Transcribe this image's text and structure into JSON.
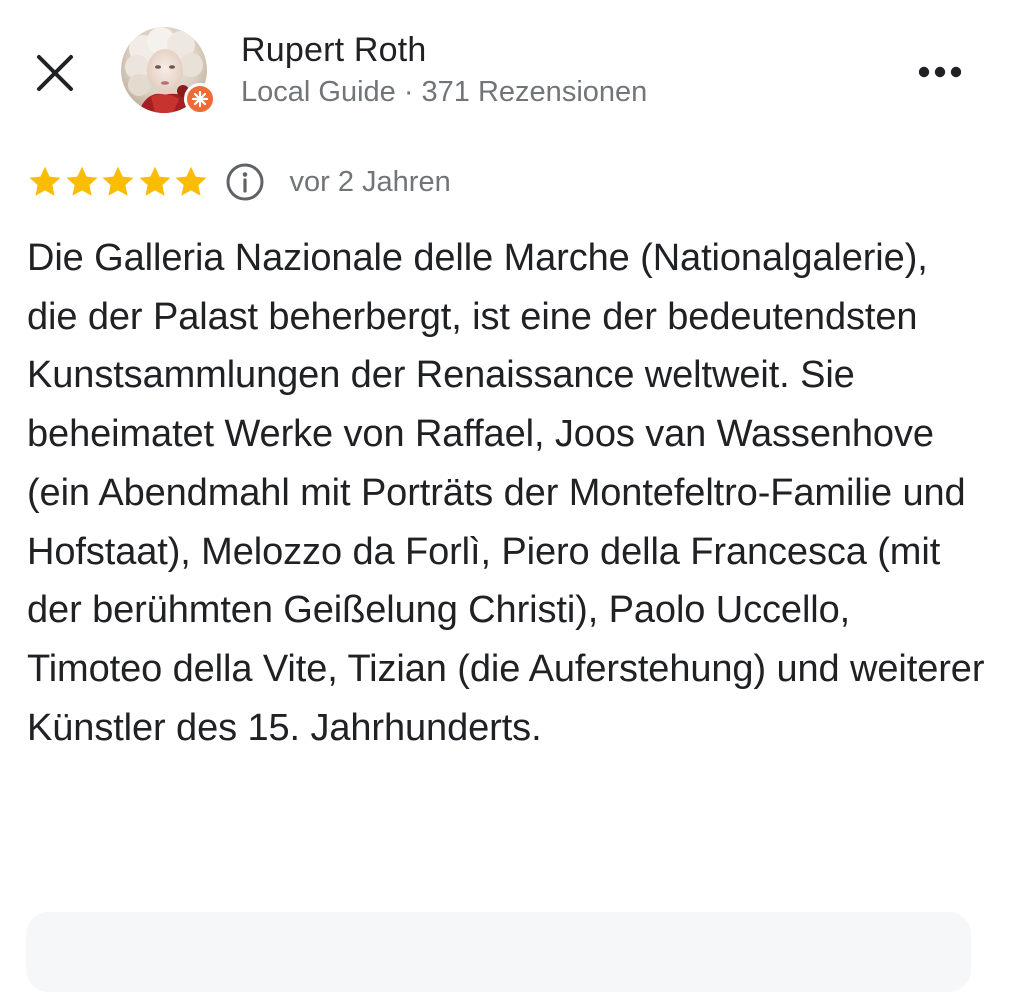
{
  "header": {
    "close_icon": "close-icon",
    "user_name": "Rupert Roth",
    "user_meta": "Local Guide · 371 Rezensionen",
    "badge_icon": "local-guide-badge-icon",
    "more_icon": "more-horizontal-icon"
  },
  "review": {
    "rating": 5,
    "rating_max": 5,
    "star_color": "#fbbc04",
    "info_icon": "info-icon",
    "date": "vor 2 Jahren",
    "text": "Die Galleria Nazionale delle Marche (Nationalgalerie), die der Palast beherbergt, ist eine der bedeutendsten Kunstsammlungen der Renaissance weltweit. Sie beheimatet Werke von Raffael, Joos van Wassenhove (ein Abendmahl mit Porträts der Montefeltro-Familie und Hofstaat), Melozzo da Forlì, Piero della Francesca (mit der berühmten Geißelung Christi), Paolo Uccello, Timoteo della Vite, Tizian (die Auferstehung) und weiterer Künstler des 15. Jahrhunderts."
  },
  "colors": {
    "text_primary": "#202124",
    "text_secondary": "#70757a",
    "badge": "#ee6b36",
    "card_bg": "#f6f7f9"
  }
}
